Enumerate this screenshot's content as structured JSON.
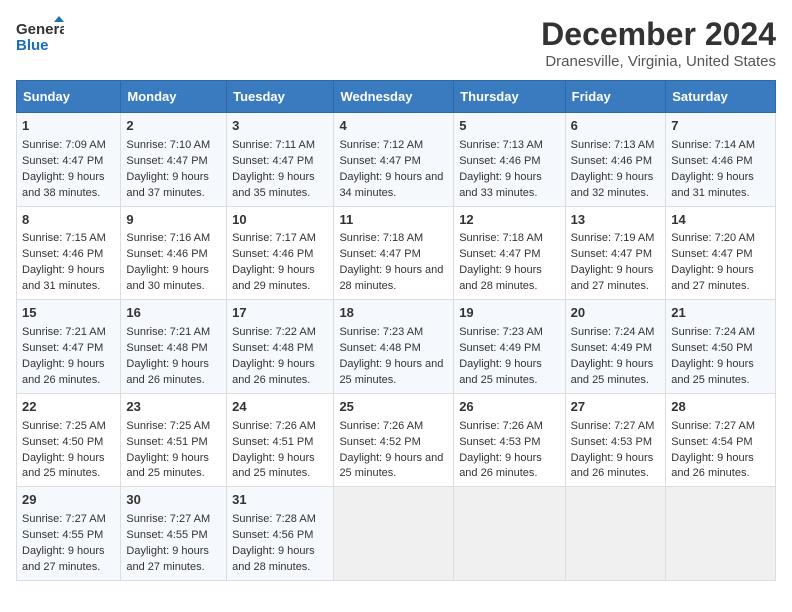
{
  "header": {
    "logo_line1": "General",
    "logo_line2": "Blue",
    "title": "December 2024",
    "subtitle": "Dranesville, Virginia, United States"
  },
  "columns": [
    "Sunday",
    "Monday",
    "Tuesday",
    "Wednesday",
    "Thursday",
    "Friday",
    "Saturday"
  ],
  "weeks": [
    [
      {
        "day": "1",
        "sunrise": "Sunrise: 7:09 AM",
        "sunset": "Sunset: 4:47 PM",
        "daylight": "Daylight: 9 hours and 38 minutes."
      },
      {
        "day": "2",
        "sunrise": "Sunrise: 7:10 AM",
        "sunset": "Sunset: 4:47 PM",
        "daylight": "Daylight: 9 hours and 37 minutes."
      },
      {
        "day": "3",
        "sunrise": "Sunrise: 7:11 AM",
        "sunset": "Sunset: 4:47 PM",
        "daylight": "Daylight: 9 hours and 35 minutes."
      },
      {
        "day": "4",
        "sunrise": "Sunrise: 7:12 AM",
        "sunset": "Sunset: 4:47 PM",
        "daylight": "Daylight: 9 hours and 34 minutes."
      },
      {
        "day": "5",
        "sunrise": "Sunrise: 7:13 AM",
        "sunset": "Sunset: 4:46 PM",
        "daylight": "Daylight: 9 hours and 33 minutes."
      },
      {
        "day": "6",
        "sunrise": "Sunrise: 7:13 AM",
        "sunset": "Sunset: 4:46 PM",
        "daylight": "Daylight: 9 hours and 32 minutes."
      },
      {
        "day": "7",
        "sunrise": "Sunrise: 7:14 AM",
        "sunset": "Sunset: 4:46 PM",
        "daylight": "Daylight: 9 hours and 31 minutes."
      }
    ],
    [
      {
        "day": "8",
        "sunrise": "Sunrise: 7:15 AM",
        "sunset": "Sunset: 4:46 PM",
        "daylight": "Daylight: 9 hours and 31 minutes."
      },
      {
        "day": "9",
        "sunrise": "Sunrise: 7:16 AM",
        "sunset": "Sunset: 4:46 PM",
        "daylight": "Daylight: 9 hours and 30 minutes."
      },
      {
        "day": "10",
        "sunrise": "Sunrise: 7:17 AM",
        "sunset": "Sunset: 4:46 PM",
        "daylight": "Daylight: 9 hours and 29 minutes."
      },
      {
        "day": "11",
        "sunrise": "Sunrise: 7:18 AM",
        "sunset": "Sunset: 4:47 PM",
        "daylight": "Daylight: 9 hours and 28 minutes."
      },
      {
        "day": "12",
        "sunrise": "Sunrise: 7:18 AM",
        "sunset": "Sunset: 4:47 PM",
        "daylight": "Daylight: 9 hours and 28 minutes."
      },
      {
        "day": "13",
        "sunrise": "Sunrise: 7:19 AM",
        "sunset": "Sunset: 4:47 PM",
        "daylight": "Daylight: 9 hours and 27 minutes."
      },
      {
        "day": "14",
        "sunrise": "Sunrise: 7:20 AM",
        "sunset": "Sunset: 4:47 PM",
        "daylight": "Daylight: 9 hours and 27 minutes."
      }
    ],
    [
      {
        "day": "15",
        "sunrise": "Sunrise: 7:21 AM",
        "sunset": "Sunset: 4:47 PM",
        "daylight": "Daylight: 9 hours and 26 minutes."
      },
      {
        "day": "16",
        "sunrise": "Sunrise: 7:21 AM",
        "sunset": "Sunset: 4:48 PM",
        "daylight": "Daylight: 9 hours and 26 minutes."
      },
      {
        "day": "17",
        "sunrise": "Sunrise: 7:22 AM",
        "sunset": "Sunset: 4:48 PM",
        "daylight": "Daylight: 9 hours and 26 minutes."
      },
      {
        "day": "18",
        "sunrise": "Sunrise: 7:23 AM",
        "sunset": "Sunset: 4:48 PM",
        "daylight": "Daylight: 9 hours and 25 minutes."
      },
      {
        "day": "19",
        "sunrise": "Sunrise: 7:23 AM",
        "sunset": "Sunset: 4:49 PM",
        "daylight": "Daylight: 9 hours and 25 minutes."
      },
      {
        "day": "20",
        "sunrise": "Sunrise: 7:24 AM",
        "sunset": "Sunset: 4:49 PM",
        "daylight": "Daylight: 9 hours and 25 minutes."
      },
      {
        "day": "21",
        "sunrise": "Sunrise: 7:24 AM",
        "sunset": "Sunset: 4:50 PM",
        "daylight": "Daylight: 9 hours and 25 minutes."
      }
    ],
    [
      {
        "day": "22",
        "sunrise": "Sunrise: 7:25 AM",
        "sunset": "Sunset: 4:50 PM",
        "daylight": "Daylight: 9 hours and 25 minutes."
      },
      {
        "day": "23",
        "sunrise": "Sunrise: 7:25 AM",
        "sunset": "Sunset: 4:51 PM",
        "daylight": "Daylight: 9 hours and 25 minutes."
      },
      {
        "day": "24",
        "sunrise": "Sunrise: 7:26 AM",
        "sunset": "Sunset: 4:51 PM",
        "daylight": "Daylight: 9 hours and 25 minutes."
      },
      {
        "day": "25",
        "sunrise": "Sunrise: 7:26 AM",
        "sunset": "Sunset: 4:52 PM",
        "daylight": "Daylight: 9 hours and 25 minutes."
      },
      {
        "day": "26",
        "sunrise": "Sunrise: 7:26 AM",
        "sunset": "Sunset: 4:53 PM",
        "daylight": "Daylight: 9 hours and 26 minutes."
      },
      {
        "day": "27",
        "sunrise": "Sunrise: 7:27 AM",
        "sunset": "Sunset: 4:53 PM",
        "daylight": "Daylight: 9 hours and 26 minutes."
      },
      {
        "day": "28",
        "sunrise": "Sunrise: 7:27 AM",
        "sunset": "Sunset: 4:54 PM",
        "daylight": "Daylight: 9 hours and 26 minutes."
      }
    ],
    [
      {
        "day": "29",
        "sunrise": "Sunrise: 7:27 AM",
        "sunset": "Sunset: 4:55 PM",
        "daylight": "Daylight: 9 hours and 27 minutes."
      },
      {
        "day": "30",
        "sunrise": "Sunrise: 7:27 AM",
        "sunset": "Sunset: 4:55 PM",
        "daylight": "Daylight: 9 hours and 27 minutes."
      },
      {
        "day": "31",
        "sunrise": "Sunrise: 7:28 AM",
        "sunset": "Sunset: 4:56 PM",
        "daylight": "Daylight: 9 hours and 28 minutes."
      },
      null,
      null,
      null,
      null
    ]
  ]
}
